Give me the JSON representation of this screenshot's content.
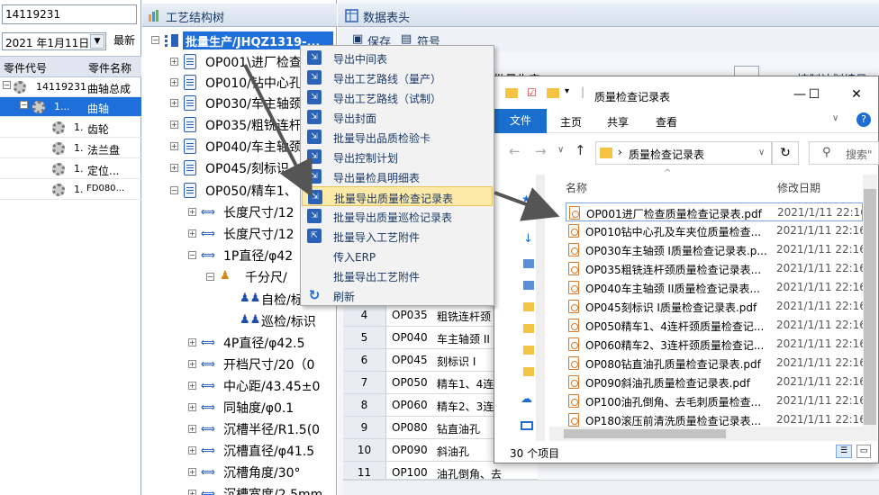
{
  "left_panel": {
    "search_value": "14119231",
    "date_value": "2021 年1月11日",
    "latest_label": "最新",
    "col_code": "零件代号",
    "col_name": "零件名称",
    "rows": [
      {
        "code": "14119231",
        "name": "曲轴总成"
      },
      {
        "code": "1...",
        "name": "曲轴"
      },
      {
        "code": "1.",
        "name": "齿轮"
      },
      {
        "code": "1.",
        "name": "法兰盘"
      },
      {
        "code": "1.",
        "name": "定位..."
      },
      {
        "code": "1.",
        "name": "FD080..."
      }
    ]
  },
  "mid_panel": {
    "title": "工艺结构树",
    "root": "批量生产/JHQZ1319-...",
    "nodes": [
      "OP001\\进厂检查",
      "OP010/钻中心孔",
      "OP030/车主轴颈",
      "OP035/粗铣连杆",
      "OP040/车主轴颈",
      "OP045/刻标识",
      "OP050/精车1、",
      "长度尺寸/12",
      "长度尺寸/12",
      "1P直径/φ42",
      "千分尺/",
      "自检/标",
      "巡检/标识",
      "4P直径/φ42.5",
      "开档尺寸/20（0",
      "中心距/43.45±0",
      "同轴度/φ0.1",
      "沉槽半径/R1.5(0",
      "沉槽直径/φ41.5",
      "沉槽角度/30°",
      "沉槽宽度/2.5mm"
    ]
  },
  "right_panel": {
    "title": "数据表头",
    "save_label": "保存",
    "symbol_label": "符号",
    "pl_label": "批量生产",
    "cp_label": "控制计划编号",
    "dots_label": "...",
    "rows": [
      {
        "n": "4",
        "op": "OP035",
        "desc": "粗铣连杆颈"
      },
      {
        "n": "5",
        "op": "OP040",
        "desc": "车主轴颈 II"
      },
      {
        "n": "6",
        "op": "OP045",
        "desc": "刻标识 I"
      },
      {
        "n": "7",
        "op": "OP050",
        "desc": "精车1、4连"
      },
      {
        "n": "8",
        "op": "OP060",
        "desc": "精车2、3连"
      },
      {
        "n": "9",
        "op": "OP080",
        "desc": "钻直油孔"
      },
      {
        "n": "10",
        "op": "OP090",
        "desc": "斜油孔"
      },
      {
        "n": "11",
        "op": "OP100",
        "desc": "油孔倒角、去"
      }
    ]
  },
  "context_menu": {
    "items": [
      "导出中间表",
      "导出工艺路线（量产）",
      "导出工艺路线（试制）",
      "导出封面",
      "批量导出品质检验卡",
      "导出控制计划",
      "导出量检具明细表",
      "批量导出质量检查记录表",
      "批量导出质量巡检记录表",
      "批量导入工艺附件",
      "传入ERP",
      "批量导出工艺附件",
      "刷新"
    ],
    "highlighted_index": 7
  },
  "explorer": {
    "title": "质量检查记录表",
    "tabs": [
      "文件",
      "主页",
      "共享",
      "查看"
    ],
    "address": "质量检查记录表",
    "search_placeholder": "搜索\"",
    "col_name": "名称",
    "col_date": "修改日期",
    "files": [
      {
        "name": "OP001进厂检查质量检查记录表.pdf",
        "date": "2021/1/11 22:16"
      },
      {
        "name": "OP010钻中心孔及车夹位质量检查...",
        "date": "2021/1/11 22:16"
      },
      {
        "name": "OP030车主轴颈 I质量检查记录表.p...",
        "date": "2021/1/11 22:16"
      },
      {
        "name": "OP035粗铣连杆颈质量检查记录表...",
        "date": "2021/1/11 22:16"
      },
      {
        "name": "OP040车主轴颈 II质量检查记录表...",
        "date": "2021/1/11 22:16"
      },
      {
        "name": "OP045刻标识 I质量检查记录表.pdf",
        "date": "2021/1/11 22:16"
      },
      {
        "name": "OP050精车1、4连杆颈质量检查记...",
        "date": "2021/1/11 22:16"
      },
      {
        "name": "OP060精车2、3连杆颈质量检查记...",
        "date": "2021/1/11 22:16"
      },
      {
        "name": "OP080钻直油孔质量检查记录表.pdf",
        "date": "2021/1/11 22:16"
      },
      {
        "name": "OP090斜油孔质量检查记录表.pdf",
        "date": "2021/1/11 22:16"
      },
      {
        "name": "OP100油孔倒角、去毛刺质量检查...",
        "date": "2021/1/11 22:16"
      },
      {
        "name": "OP180滚压前清洗质量检查记录表...",
        "date": "2021/1/11 22:16"
      }
    ],
    "status": "30 个项目"
  }
}
